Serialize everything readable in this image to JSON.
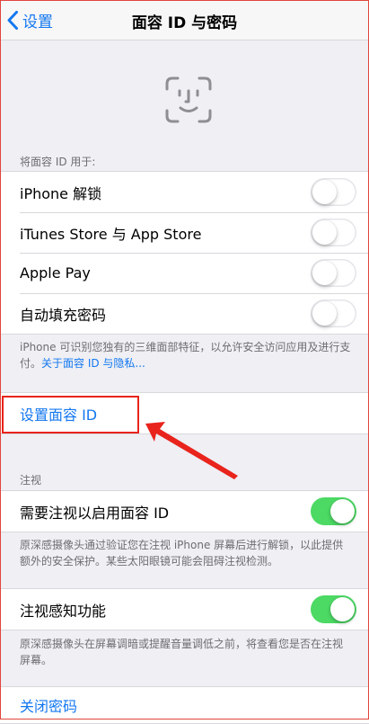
{
  "navbar": {
    "back_label": "设置",
    "title": "面容 ID 与密码"
  },
  "use_section": {
    "header": "将面容 ID 用于:",
    "items": [
      {
        "label": "iPhone 解锁",
        "on": false
      },
      {
        "label": "iTunes Store 与 App Store",
        "on": false
      },
      {
        "label": "Apple Pay",
        "on": false
      },
      {
        "label": "自动填充密码",
        "on": false
      }
    ],
    "footer_text": "iPhone 可识别您独有的三维面部特征，以允许安全访问应用及进行支付。",
    "footer_link": "关于面容 ID 与隐私..."
  },
  "setup_face_id": {
    "label": "设置面容 ID"
  },
  "attention_section": {
    "header": "注视",
    "require_attention": {
      "label": "需要注视以启用面容 ID",
      "on": true
    },
    "require_attention_footer": "原深感摄像头通过验证您在注视 iPhone 屏幕后进行解锁，以此提供额外的安全保护。某些太阳眼镜可能会阻碍注视检测。",
    "attention_aware": {
      "label": "注视感知功能",
      "on": true
    },
    "attention_aware_footer": "原深感摄像头在屏幕调暗或提醒音量调低之前，将查看您是否在注视屏幕。"
  },
  "passcode": {
    "turn_off_label": "关闭密码"
  },
  "colors": {
    "accent": "#1478ef",
    "toggle_on": "#4cd964",
    "annotation": "#e8241c"
  },
  "icons": {
    "back": "chevron-left-icon",
    "face": "face-id-icon",
    "annotation": "red-arrow"
  }
}
